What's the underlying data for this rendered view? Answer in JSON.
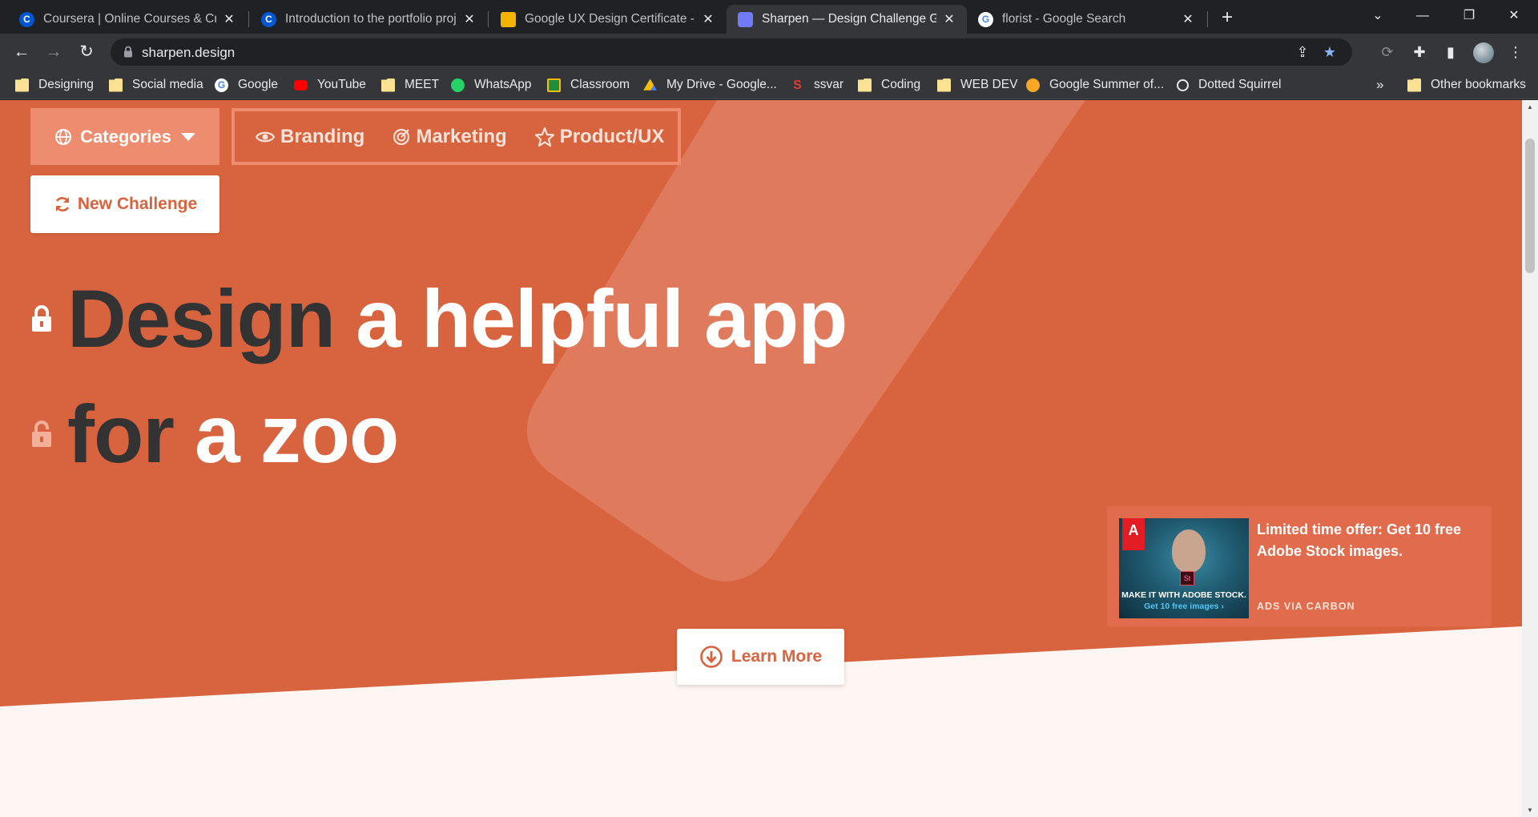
{
  "browser": {
    "tabs": [
      {
        "title": "Coursera | Online Courses & Credentials",
        "favicon": "coursera-icon",
        "color": "#0056d2",
        "glyph": "C"
      },
      {
        "title": "Introduction to the portfolio project",
        "favicon": "coursera-icon",
        "color": "#0056d2",
        "glyph": "C"
      },
      {
        "title": "Google UX Design Certificate - Portfolio",
        "favicon": "google-slides-icon",
        "color": "#f4b400",
        "glyph": ""
      },
      {
        "title": "Sharpen — Design Challenge Generator",
        "favicon": "sharpen-icon",
        "color": "#6f7bf7",
        "glyph": ""
      },
      {
        "title": "florist - Google Search",
        "favicon": "google-icon",
        "color": "#ffffff",
        "glyph": "G"
      }
    ],
    "url": "sharpen.design",
    "bookmarks": [
      {
        "label": "Designing",
        "icon": "folder-icon"
      },
      {
        "label": "Social media",
        "icon": "folder-icon"
      },
      {
        "label": "Google",
        "icon": "google-icon"
      },
      {
        "label": "YouTube",
        "icon": "youtube-icon"
      },
      {
        "label": "MEET",
        "icon": "folder-icon"
      },
      {
        "label": "WhatsApp",
        "icon": "whatsapp-icon"
      },
      {
        "label": "Classroom",
        "icon": "classroom-icon"
      },
      {
        "label": "My Drive - Google...",
        "icon": "drive-icon"
      },
      {
        "label": "ssvar",
        "icon": "ssvar-icon"
      },
      {
        "label": "Coding",
        "icon": "folder-icon"
      },
      {
        "label": "WEB DEV",
        "icon": "folder-icon"
      },
      {
        "label": "Google Summer of...",
        "icon": "gsoc-icon"
      },
      {
        "label": "Dotted Squirrel",
        "icon": "dotted-squirrel-icon"
      }
    ],
    "overflow": "»",
    "other_bookmarks": "Other bookmarks"
  },
  "page": {
    "categories_label": "Categories",
    "filters": [
      {
        "label": "Branding",
        "icon": "eye-icon"
      },
      {
        "label": "Marketing",
        "icon": "target-icon"
      },
      {
        "label": "Product/UX",
        "icon": "star-icon"
      }
    ],
    "new_challenge_label": "New Challenge",
    "challenge": {
      "line1": [
        {
          "word": "Design",
          "tone": "dark"
        },
        {
          "word": "a",
          "tone": "light"
        },
        {
          "word": "helpful",
          "tone": "light"
        },
        {
          "word": "app",
          "tone": "light"
        }
      ],
      "line2": [
        {
          "word": "for",
          "tone": "dark"
        },
        {
          "word": "a",
          "tone": "light"
        },
        {
          "word": "zoo",
          "tone": "light"
        }
      ],
      "line1_lock": "locked",
      "line2_lock": "unlocked"
    },
    "learn_more_label": "Learn More",
    "ad": {
      "text": "Limited time offer: Get 10 free Adobe Stock images.",
      "via": "ADS VIA CARBON",
      "image_caption": "MAKE IT WITH ADOBE STOCK.",
      "image_cta": "Get 10 free images ›",
      "logo_text": "A",
      "badge_text": "St"
    },
    "colors": {
      "hero": "#d8643f",
      "accent_soft": "#ee8c6f",
      "below_fold": "#fdf6f2",
      "dark_word": "#333333"
    }
  }
}
